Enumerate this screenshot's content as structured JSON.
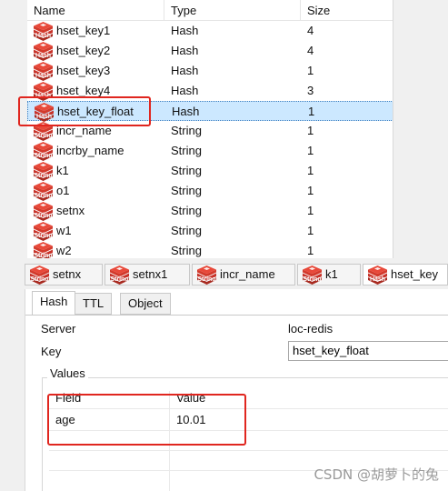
{
  "keylist": {
    "columns": [
      "Name",
      "Type",
      "Size"
    ],
    "rows": [
      {
        "icon": "Hash",
        "name": "hset_key1",
        "type": "Hash",
        "size": "4"
      },
      {
        "icon": "Hash",
        "name": "hset_key2",
        "type": "Hash",
        "size": "4"
      },
      {
        "icon": "Hash",
        "name": "hset_key3",
        "type": "Hash",
        "size": "1"
      },
      {
        "icon": "Hash",
        "name": "hset_key4",
        "type": "Hash",
        "size": "3"
      },
      {
        "icon": "Hash",
        "name": "hset_key_float",
        "type": "Hash",
        "size": "1"
      },
      {
        "icon": "String",
        "name": "incr_name",
        "type": "String",
        "size": "1"
      },
      {
        "icon": "String",
        "name": "incrby_name",
        "type": "String",
        "size": "1"
      },
      {
        "icon": "String",
        "name": "k1",
        "type": "String",
        "size": "1"
      },
      {
        "icon": "String",
        "name": "o1",
        "type": "String",
        "size": "1"
      },
      {
        "icon": "String",
        "name": "setnx",
        "type": "String",
        "size": "1"
      },
      {
        "icon": "String",
        "name": "w1",
        "type": "String",
        "size": "1"
      },
      {
        "icon": "String",
        "name": "w2",
        "type": "String",
        "size": "1"
      }
    ]
  },
  "open_tabs": [
    {
      "icon": "String",
      "label": "setnx"
    },
    {
      "icon": "String",
      "label": "setnx1"
    },
    {
      "icon": "String",
      "label": "incr_name"
    },
    {
      "icon": "String",
      "label": "k1"
    },
    {
      "icon": "Hash",
      "label": "hset_key"
    }
  ],
  "detail": {
    "tabs": [
      "Hash",
      "TTL",
      "Object"
    ],
    "server_label": "Server",
    "server_value": "loc-redis",
    "key_label": "Key",
    "key_value": "hset_key_float",
    "values_title": "Values",
    "table": {
      "columns": [
        "Field",
        "Value"
      ],
      "rows": [
        {
          "field": "age",
          "value": "10.01"
        }
      ]
    }
  },
  "watermark": "CSDN @胡萝卜的兔",
  "colors": {
    "selection": "#cce8ff",
    "highlight_box": "#e0261f",
    "icon_red": "#d33a2c"
  }
}
